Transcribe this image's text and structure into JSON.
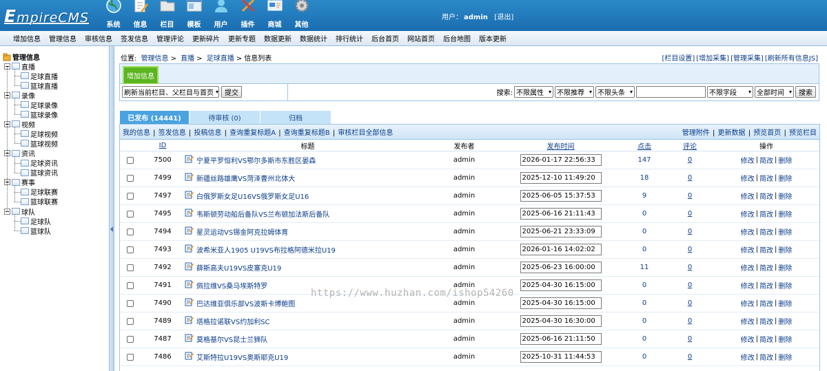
{
  "header": {
    "logo_text": "EmpireCMS",
    "icons": [
      {
        "label": "系统",
        "icon": "globe-icon"
      },
      {
        "label": "信息",
        "icon": "edit-document-icon"
      },
      {
        "label": "栏目",
        "icon": "folder-icon"
      },
      {
        "label": "模板",
        "icon": "template-icon"
      },
      {
        "label": "用户",
        "icon": "user-icon"
      },
      {
        "label": "插件",
        "icon": "plugin-tools-icon"
      },
      {
        "label": "商城",
        "icon": "shop-card-icon"
      },
      {
        "label": "其他",
        "icon": "gear-icon"
      }
    ],
    "user_label": "用户：",
    "username": "admin",
    "logout": "[退出]"
  },
  "menu": [
    "增加信息",
    "管理信息",
    "审核信息",
    "签发信息",
    "管理评论",
    "更新碎片",
    "更新专题",
    "数据更新",
    "数据统计",
    "排行统计",
    "后台首页",
    "网站首页",
    "后台地图",
    "版本更新"
  ],
  "sidebar": {
    "root": "管理信息",
    "groups": [
      {
        "label": "直播",
        "children": [
          "足球直播",
          "篮球直播"
        ]
      },
      {
        "label": "录像",
        "children": [
          "足球录像",
          "篮球录像"
        ]
      },
      {
        "label": "视频",
        "children": [
          "足球视频",
          "篮球视频"
        ]
      },
      {
        "label": "资讯",
        "children": [
          "足球资讯",
          "篮球资讯"
        ]
      },
      {
        "label": "赛事",
        "children": [
          "足球联赛",
          "篮球联赛"
        ]
      },
      {
        "label": "球队",
        "children": [
          "足球队",
          "篮球队"
        ]
      }
    ]
  },
  "breadcrumb": {
    "prefix": "位置:",
    "items": [
      "管理信息",
      "直播",
      "足球直播"
    ],
    "sep": ">",
    "current": "信息列表"
  },
  "top_links": [
    "[栏目设置]",
    "[增加采集]",
    "[管理采集]",
    "[刷新所有信息JS]"
  ],
  "add_button": "增加信息",
  "refresh_select": "刷新当前栏目、父栏目与首页",
  "submit_button": "提交",
  "search": {
    "label": "搜索:",
    "attr_select": "不限属性",
    "recommend_select": "不限推荐",
    "headline_select": "不限头条",
    "keyword": "",
    "field_select": "不限字段",
    "time_select": "全部时间",
    "button": "搜索"
  },
  "tabs": [
    "已发布 (14441)",
    "待审核 (0)",
    "归档"
  ],
  "action_links_left": [
    "我的信息",
    "签发信息",
    "投稿信息",
    "查询重复标题A",
    "查询重复标题B",
    "审核栏目全部信息"
  ],
  "action_links_right": [
    "管理附件",
    "更新数据",
    "预览首页",
    "预览栏目"
  ],
  "table": {
    "headers": {
      "id": "ID",
      "title": "标题",
      "publisher": "发布者",
      "time": "发布时间",
      "clicks": "点击",
      "comments": "评论",
      "ops": "操作"
    },
    "op_labels": [
      "修改",
      "简改",
      "删除"
    ],
    "rows": [
      {
        "id": "7500",
        "title": "宁夏平罗恒利VS鄂尔多斯市东胜区晏森",
        "publisher": "admin",
        "time": "2026-01-17 22:56:33",
        "clicks": "147",
        "comments": "0"
      },
      {
        "id": "7499",
        "title": "新疆丝路雄鹰VS菏泽曹州北体大",
        "publisher": "admin",
        "time": "2025-12-10 11:49:20",
        "clicks": "18",
        "comments": "0"
      },
      {
        "id": "7497",
        "title": "白俄罗斯女足U16VS俄罗斯女足U16",
        "publisher": "admin",
        "time": "2025-06-05 15:37:53",
        "clicks": "9",
        "comments": "0"
      },
      {
        "id": "7495",
        "title": "韦斯顿劳动船后备队VS兰布顿加法斯后备队",
        "publisher": "admin",
        "time": "2025-06-16 21:11:43",
        "clicks": "0",
        "comments": "0"
      },
      {
        "id": "7494",
        "title": "星灵运动VS锡金阿克拉姆体育",
        "publisher": "admin",
        "time": "2025-06-21 23:33:09",
        "clicks": "0",
        "comments": "0"
      },
      {
        "id": "7493",
        "title": "波希米亚人1905 U19VS布拉格阿德米拉U19",
        "publisher": "admin",
        "time": "2026-01-16 14:02:02",
        "clicks": "0",
        "comments": "0"
      },
      {
        "id": "7492",
        "title": "薛斯高夫U19VS皮塞克U19",
        "publisher": "admin",
        "time": "2025-06-23 16:00:00",
        "clicks": "11",
        "comments": "0"
      },
      {
        "id": "7491",
        "title": "佩拉维VS桑马埃斯特罗",
        "publisher": "admin",
        "time": "2025-04-30 16:15:00",
        "clicks": "0",
        "comments": "0"
      },
      {
        "id": "7490",
        "title": "巴达维亚俱乐部VS波斯卡博鲍图",
        "publisher": "admin",
        "time": "2025-04-30 16:15:00",
        "clicks": "0",
        "comments": "0"
      },
      {
        "id": "7489",
        "title": "塔格拉诺联VS约加利SC",
        "publisher": "admin",
        "time": "2025-04-30 16:30:00",
        "clicks": "0",
        "comments": "0"
      },
      {
        "id": "7487",
        "title": "莫格基尔VS昆士兰狮队",
        "publisher": "admin",
        "time": "2025-06-16 21:11:50",
        "clicks": "0",
        "comments": "0"
      },
      {
        "id": "7486",
        "title": "艾斯特拉U19VS奥斯耶克U19",
        "publisher": "admin",
        "time": "2025-10-31 11:44:53",
        "clicks": "0",
        "comments": "0"
      }
    ]
  },
  "watermark": "https://www.huzhan.com/ishop54260"
}
